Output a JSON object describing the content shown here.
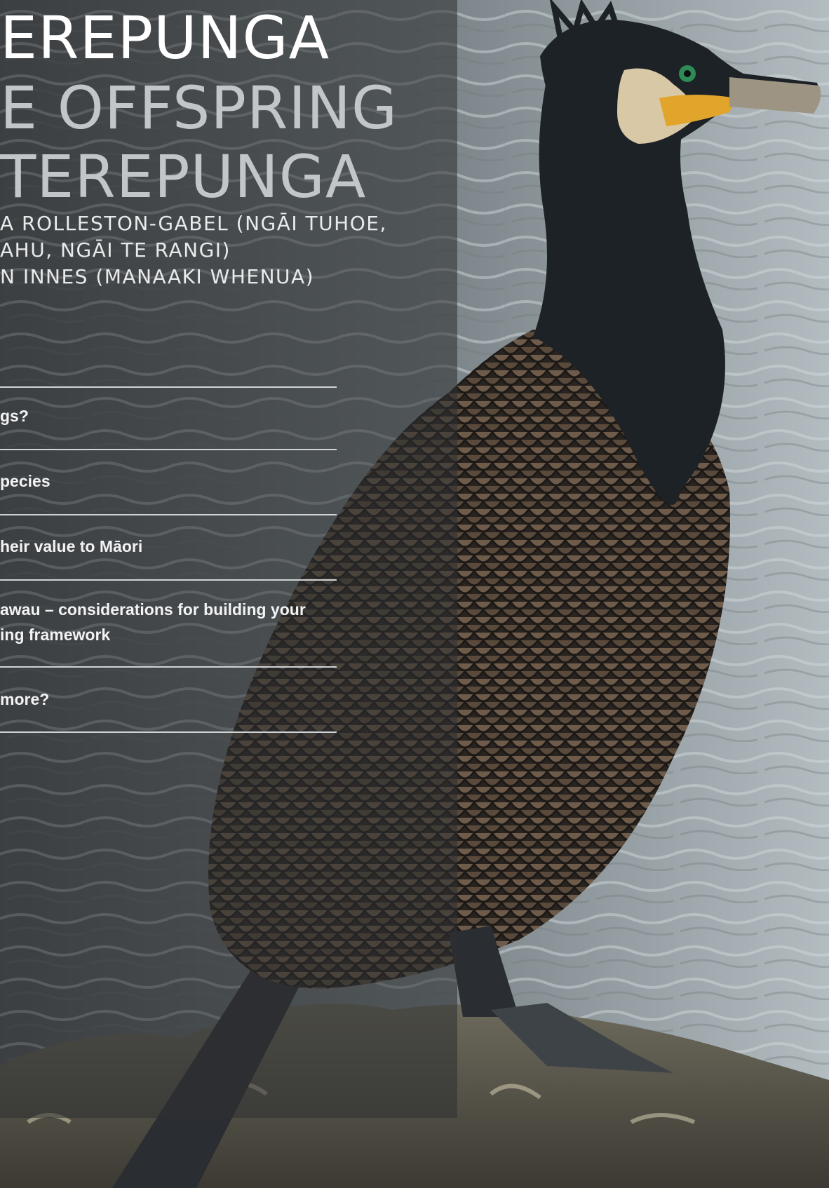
{
  "cover": {
    "title_lines": [
      "EREPUNGA",
      "E OFFSPRING",
      " TEREPUNGA"
    ],
    "author_lines": [
      "A ROLLESTON-GABEL (NGĀI TUHOE,",
      "AHU, NGĀI TE RANGI)",
      "N INNES (MANAAKI WHENUA)"
    ]
  },
  "contents": {
    "entries": [
      {
        "lines": [
          "gs?"
        ]
      },
      {
        "lines": [
          "pecies"
        ]
      },
      {
        "lines": [
          "heir value to Māori"
        ]
      },
      {
        "lines": [
          "awau – considerations for building your",
          "ing framework"
        ]
      },
      {
        "lines": [
          " more?"
        ]
      }
    ]
  },
  "photo": {
    "subject": "shag-photo",
    "colors": {
      "water": "#9ba4a8",
      "panel": "#2e3032",
      "feathers": "#3a3026",
      "neck": "#1c2226",
      "beak_patch": "#e0a52a"
    }
  }
}
